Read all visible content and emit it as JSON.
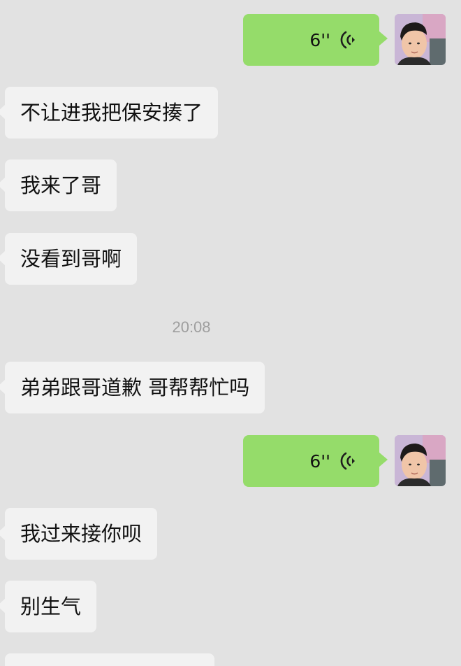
{
  "messages": [
    {
      "side": "right",
      "kind": "voice",
      "duration": "6''"
    },
    {
      "side": "left",
      "text": "不让进我把保安揍了"
    },
    {
      "side": "left",
      "text": "我来了哥"
    },
    {
      "side": "left",
      "text": "没看到哥啊"
    },
    {
      "side": "left",
      "text": "弟弟跟哥道歉 哥帮帮忙吗"
    },
    {
      "side": "right",
      "kind": "voice",
      "duration": "6''"
    },
    {
      "side": "left",
      "text": "我过来接你呗"
    },
    {
      "side": "left",
      "text": "别生气"
    }
  ],
  "timestamp": "20:08",
  "colors": {
    "background": "#e2e2e2",
    "incoming_bubble": "#f2f2f2",
    "outgoing_bubble": "#95dc6a",
    "timestamp_text": "#9e9e9e"
  },
  "icons": {
    "voice": "voice-wave-icon",
    "avatar": "user-avatar"
  }
}
